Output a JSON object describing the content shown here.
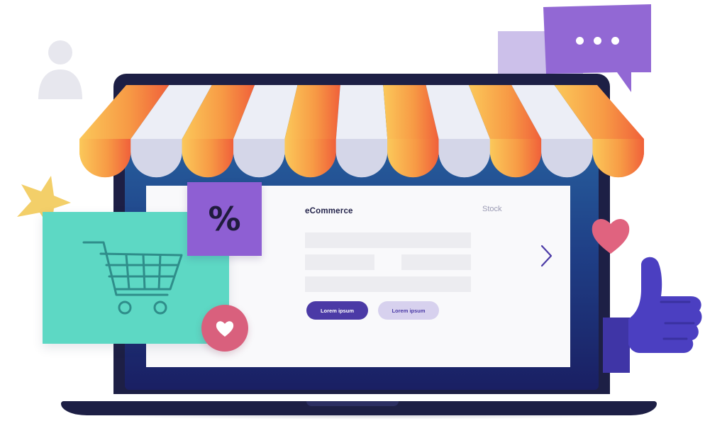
{
  "panel": {
    "title": "eCommerce",
    "stock_label": "Stock"
  },
  "buttons": {
    "primary_label": "Lorem ipsum",
    "secondary_label": "Lorem ipsum"
  },
  "percent_tag": {
    "symbol": "%"
  },
  "icons": {
    "cart": "shopping-cart-icon",
    "heart": "heart-icon",
    "star": "star-icon",
    "user": "user-icon",
    "thumbs_up": "thumbs-up-icon",
    "chevron": "chevron-right-icon",
    "chat": "chat-bubble-icon"
  },
  "colors": {
    "accent_purple": "#4b3aa6",
    "teal_card": "#5dd8c4",
    "tag_purple": "#8e5fd3",
    "heart_pink": "#d9607d",
    "awning_orange": "#f47c3c",
    "awning_yellow": "#fbc85a",
    "awning_white": "#d9dbea"
  }
}
